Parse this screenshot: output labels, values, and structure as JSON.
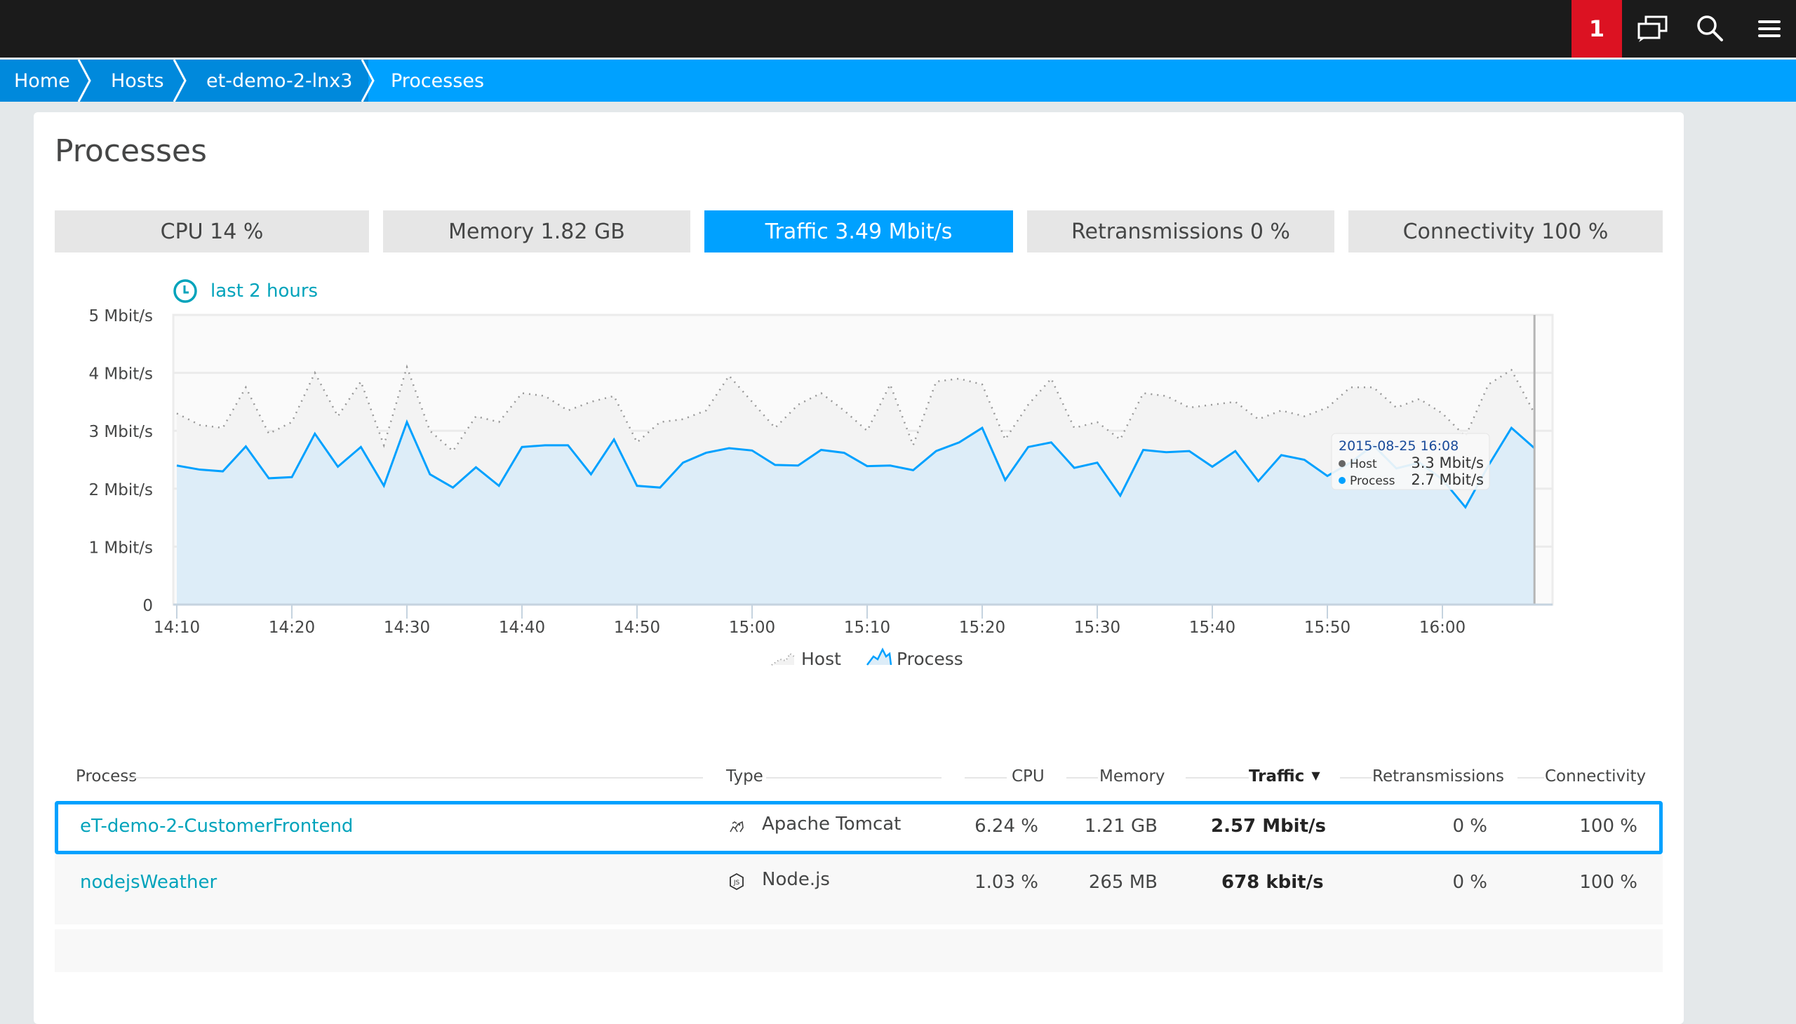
{
  "topbar": {
    "notification_count": "1",
    "icons": [
      "chat-icon",
      "search-icon",
      "menu-icon"
    ]
  },
  "breadcrumb": [
    {
      "label": "Home"
    },
    {
      "label": "Hosts"
    },
    {
      "label": "et-demo-2-lnx3"
    },
    {
      "label": "Processes"
    }
  ],
  "page": {
    "title": "Processes"
  },
  "tabs": [
    {
      "label": "CPU 14 %",
      "active": false
    },
    {
      "label": "Memory 1.82 GB",
      "active": false
    },
    {
      "label": "Traffic 3.49 Mbit/s",
      "active": true
    },
    {
      "label": "Retransmissions 0 %",
      "active": false
    },
    {
      "label": "Connectivity 100 %",
      "active": false
    }
  ],
  "timeframe": {
    "label": "last 2 hours"
  },
  "colors": {
    "accent": "#00a1ff",
    "breadcrumb_dark": "#0089dc",
    "topbar": "#1b1b1b",
    "alert": "#dc1222",
    "link": "#00a3bb",
    "process_fill": "#ddedf8",
    "host_fill": "#f5f5f5"
  },
  "chart_data": {
    "type": "area",
    "title": "",
    "xlabel": "",
    "ylabel": "",
    "y_unit": "Mbit/s",
    "ylim": [
      0,
      5
    ],
    "yticks": [
      "0",
      "1 Mbit/s",
      "2 Mbit/s",
      "3 Mbit/s",
      "4 Mbit/s",
      "5 Mbit/s"
    ],
    "xticks": [
      "14:10",
      "14:20",
      "14:30",
      "14:40",
      "14:50",
      "15:00",
      "15:10",
      "15:20",
      "15:30",
      "15:40",
      "15:50",
      "16:00"
    ],
    "x_start": "14:10",
    "x_step_minutes": 2,
    "grid": true,
    "legend": "bottom-center",
    "series": [
      {
        "name": "Host",
        "style": "dotted",
        "values": [
          3.3,
          3.1,
          3.05,
          3.75,
          2.95,
          3.15,
          4.0,
          3.25,
          3.85,
          2.75,
          4.1,
          3.0,
          2.65,
          3.25,
          3.15,
          3.65,
          3.6,
          3.35,
          3.5,
          3.6,
          2.8,
          3.15,
          3.2,
          3.35,
          3.95,
          3.5,
          3.05,
          3.45,
          3.65,
          3.35,
          3.0,
          3.8,
          2.75,
          3.85,
          3.9,
          3.8,
          2.85,
          3.45,
          3.9,
          3.05,
          3.15,
          2.85,
          3.65,
          3.6,
          3.4,
          3.45,
          3.5,
          3.2,
          3.35,
          3.25,
          3.4,
          3.75,
          3.75,
          3.4,
          3.55,
          3.3,
          2.9,
          3.8,
          4.05,
          3.3
        ],
        "color": "#888888"
      },
      {
        "name": "Process",
        "style": "solid",
        "values": [
          2.4,
          2.33,
          2.3,
          2.73,
          2.18,
          2.2,
          2.95,
          2.38,
          2.72,
          2.05,
          3.15,
          2.25,
          2.02,
          2.37,
          2.05,
          2.72,
          2.75,
          2.75,
          2.25,
          2.85,
          2.05,
          2.02,
          2.45,
          2.62,
          2.7,
          2.66,
          2.41,
          2.4,
          2.67,
          2.62,
          2.39,
          2.4,
          2.32,
          2.65,
          2.8,
          3.05,
          2.15,
          2.72,
          2.8,
          2.36,
          2.45,
          1.88,
          2.67,
          2.63,
          2.65,
          2.38,
          2.65,
          2.13,
          2.58,
          2.5,
          2.22,
          2.45,
          2.75,
          2.35,
          2.45,
          2.16,
          1.68,
          2.4,
          3.05,
          2.7
        ],
        "color": "#00a1ff"
      }
    ],
    "tooltip": {
      "timestamp": "2015-08-25 16:08",
      "rows": [
        {
          "name": "Host",
          "value": "3.3 Mbit/s",
          "color": "#666666"
        },
        {
          "name": "Process",
          "value": "2.7 Mbit/s",
          "color": "#00a1ff"
        }
      ]
    }
  },
  "table": {
    "columns": [
      "Process",
      "Type",
      "CPU",
      "Memory",
      "Traffic",
      "Retransmissions",
      "Connectivity"
    ],
    "sort_column": "Traffic",
    "sort_indicator": "▼",
    "rows": [
      {
        "process": "eT-demo-2-CustomerFrontend",
        "type_icon": "tomcat-icon",
        "type": "Apache Tomcat",
        "cpu": "6.24 %",
        "memory": "1.21 GB",
        "traffic": "2.57 Mbit/s",
        "retransmissions": "0 %",
        "connectivity": "100 %",
        "selected": true
      },
      {
        "process": "nodejsWeather",
        "type_icon": "nodejs-icon",
        "type": "Node.js",
        "cpu": "1.03 %",
        "memory": "265 MB",
        "traffic": "678 kbit/s",
        "retransmissions": "0 %",
        "connectivity": "100 %",
        "selected": false
      }
    ]
  }
}
